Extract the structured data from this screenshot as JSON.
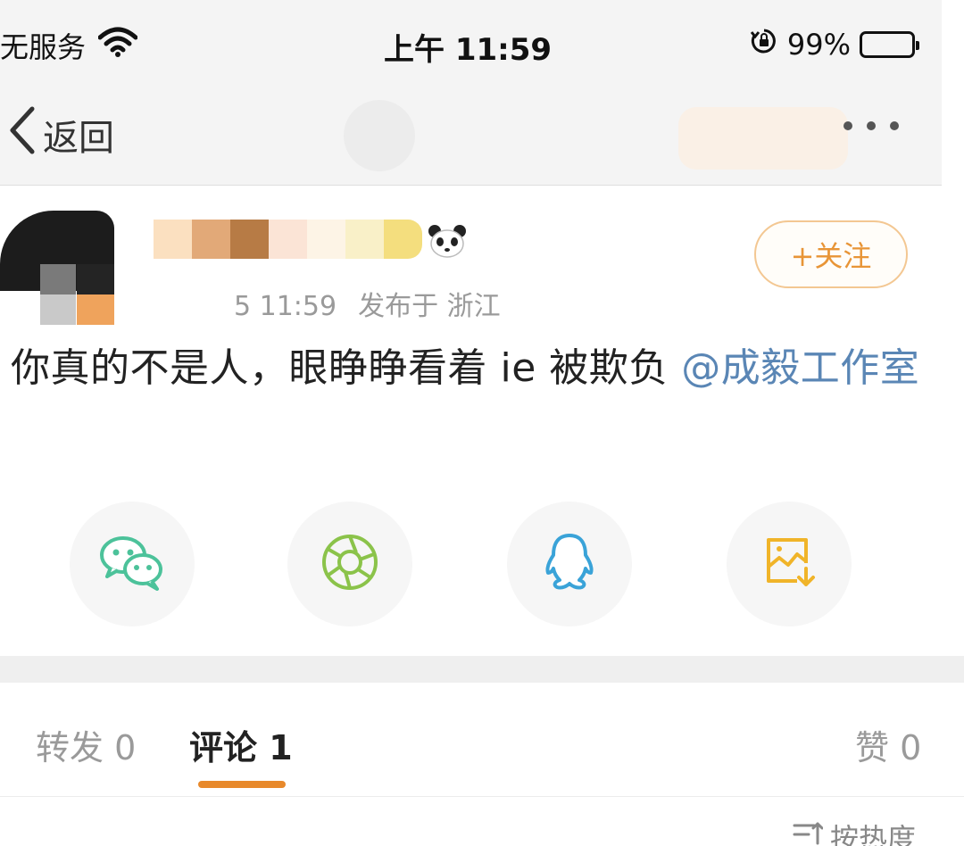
{
  "status_bar": {
    "carrier": "无服务",
    "time": "上午 11:59",
    "battery": "99%",
    "battery_level": 0.99
  },
  "nav": {
    "back_label": "返回"
  },
  "post": {
    "meta_time": "5 11:59",
    "meta_location": "发布于 浙江",
    "follow_label": "+关注",
    "text_main": "你真的不是人，眼睁睁看着 ie 被欺负 ",
    "mention": "@成毅工作室"
  },
  "share_icons": [
    "wechat-icon",
    "moments-icon",
    "qq-icon",
    "save-image-icon"
  ],
  "tabs": {
    "repost": "转发 0",
    "comment": "评论 1",
    "like": "赞 0"
  },
  "sort": {
    "label": "按热度"
  },
  "colors": {
    "accent": "#e8892b",
    "mention": "#5a86b5",
    "wechat": "#4cc29a",
    "moments": "#8bc34a",
    "qq": "#3aa3d8",
    "save": "#f0b429"
  }
}
